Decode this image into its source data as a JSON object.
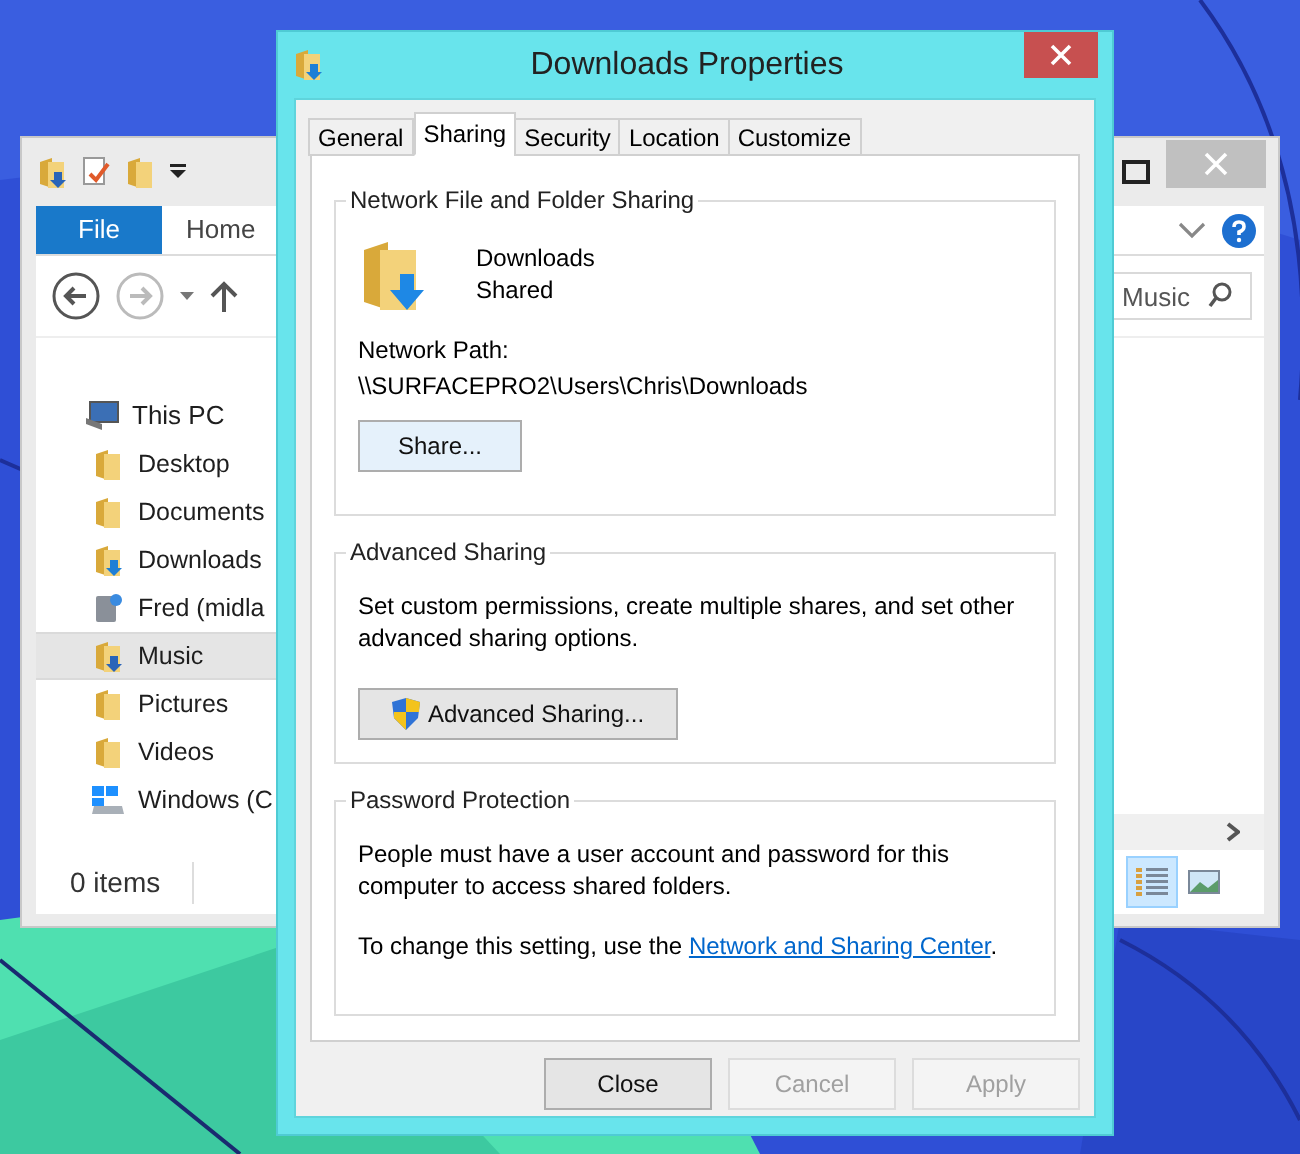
{
  "explorer": {
    "ribbon_tabs": [
      {
        "label": "File",
        "kind": "file"
      },
      {
        "label": "Home",
        "kind": "tab"
      }
    ],
    "search": {
      "placeholder": "Music"
    },
    "nav_tree": [
      {
        "label": "This PC",
        "kind": "computer",
        "selected": false,
        "children": [
          {
            "label": "Desktop",
            "kind": "folder",
            "selected": false
          },
          {
            "label": "Documents",
            "kind": "folder",
            "selected": false
          },
          {
            "label": "Downloads",
            "kind": "download-folder",
            "selected": false
          },
          {
            "label": "Fred (midla",
            "kind": "network-drive",
            "selected": false
          },
          {
            "label": "Music",
            "kind": "music-folder",
            "selected": true
          },
          {
            "label": "Pictures",
            "kind": "folder",
            "selected": false
          },
          {
            "label": "Videos",
            "kind": "folder",
            "selected": false
          },
          {
            "label": "Windows (C",
            "kind": "drive",
            "selected": false
          }
        ]
      }
    ],
    "status_bar": "0 items",
    "views": [
      {
        "kind": "details",
        "selected": true
      },
      {
        "kind": "large-icons",
        "selected": false
      }
    ]
  },
  "dialog": {
    "title": "Downloads Properties",
    "tabs": [
      {
        "label": "General",
        "selected": false
      },
      {
        "label": "Sharing",
        "selected": true
      },
      {
        "label": "Security",
        "selected": false
      },
      {
        "label": "Location",
        "selected": false
      },
      {
        "label": "Customize",
        "selected": false
      }
    ],
    "network_sharing": {
      "heading": "Network File and Folder Sharing",
      "name": "Downloads",
      "status": "Shared",
      "path_label": "Network Path:",
      "path": "\\\\SURFACEPRO2\\Users\\Chris\\Downloads",
      "button": "Share..."
    },
    "advanced_sharing": {
      "heading": "Advanced Sharing",
      "description": "Set custom permissions, create multiple shares, and set other advanced sharing options.",
      "button": "Advanced Sharing..."
    },
    "password_protection": {
      "heading": "Password Protection",
      "description": "People must have a user account and password for this computer to access shared folders.",
      "hint_before": "To change this setting, use the",
      "link": "Network and Sharing Center",
      "hint_after": "."
    },
    "buttons": [
      {
        "label": "Close",
        "disabled": false
      },
      {
        "label": "Cancel",
        "disabled": true
      },
      {
        "label": "Apply",
        "disabled": true
      }
    ]
  }
}
